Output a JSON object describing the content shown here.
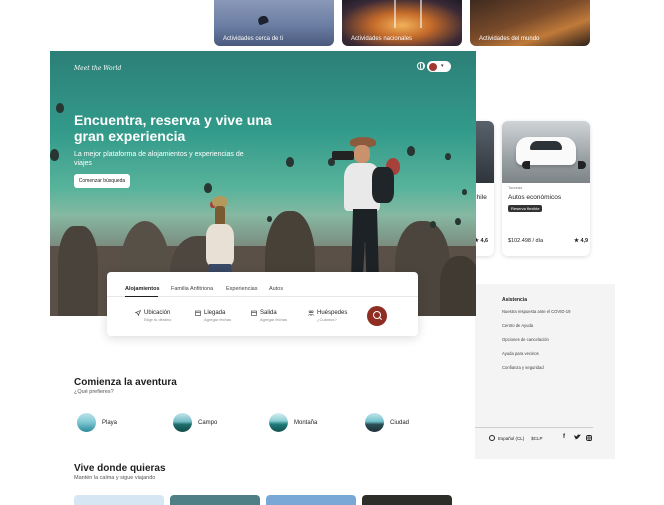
{
  "top_activities": [
    {
      "label": "Actividades cerca de ti"
    },
    {
      "label": "Actividades nacionales"
    },
    {
      "label": "Actividades del mundo"
    }
  ],
  "right_cards": {
    "partial_title": "Chile",
    "partial_rating": "4,6",
    "card": {
      "tag": "Toureas",
      "title": "Autos económicos",
      "badge": "Reserva flexible",
      "price": "$102.498 / día",
      "rating": "4,9"
    }
  },
  "footer_panel": {
    "heading": "Asistencia",
    "links": [
      "Nuestra respuesta ante el COVID-19",
      "Centro de Ayuda",
      "Opciones de cancelación",
      "Ayuda para vecinos",
      "Confianza y seguridad"
    ],
    "language": "Español (CL)",
    "currency": "$CLP",
    "social_icons": [
      "facebook-icon",
      "twitter-icon",
      "instagram-icon"
    ]
  },
  "hero": {
    "brand": "Meet the World",
    "title": "Encuentra, reserva y  vive una gran experiencia",
    "subtitle": "La mejor plataforma de alojamientos y experiencias de viajes",
    "cta": "Comenzar búsqueda"
  },
  "search": {
    "tabs": [
      "Alojamientos",
      "Familia Anfitriona",
      "Experiencias",
      "Autos"
    ],
    "active_tab": "Alojamientos",
    "fields": [
      {
        "title": "Ubicación",
        "placeholder": "Elige tu destino",
        "icon": "location-arrow-icon"
      },
      {
        "title": "Llegada",
        "placeholder": "Agregar fechas",
        "icon": "calendar-icon"
      },
      {
        "title": "Salida",
        "placeholder": "Agregar fechas",
        "icon": "calendar-icon"
      },
      {
        "title": "Huéspedes",
        "placeholder": "¿Cuántos?",
        "icon": "guests-icon"
      }
    ],
    "button_icon": "search-icon",
    "accent_color": "#8f2d22"
  },
  "adventure": {
    "title": "Comienza la aventura",
    "subtitle": "¿Qué prefieres?",
    "categories": [
      "Playa",
      "Campo",
      "Montaña",
      "Ciudad"
    ]
  },
  "live": {
    "title": "Vive donde quieras",
    "subtitle": "Mantén la calma y sigue viajando"
  }
}
